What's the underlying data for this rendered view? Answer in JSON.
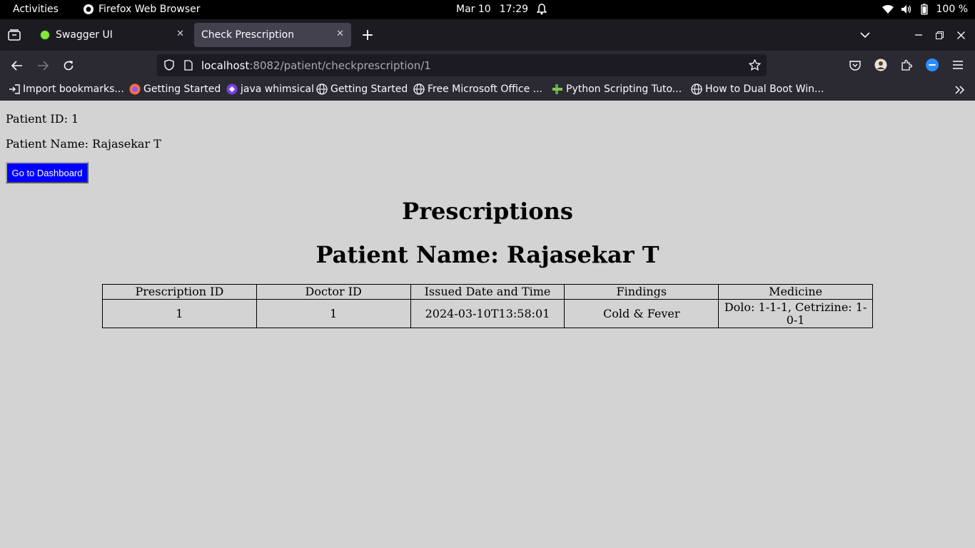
{
  "system_bar": {
    "activities": "Activities",
    "app_name": "Firefox Web Browser",
    "date": "Mar 10",
    "time": "17:29",
    "battery": "100 %"
  },
  "tabs": [
    {
      "label": "Swagger UI",
      "active": false
    },
    {
      "label": "Check Prescription",
      "active": true
    }
  ],
  "address_bar": {
    "host": "localhost",
    "path": ":8082/patient/checkprescription/1"
  },
  "bookmarks": [
    {
      "label": "Import bookmarks...",
      "icon": "import-icon"
    },
    {
      "label": "Getting Started",
      "icon": "firefox-icon"
    },
    {
      "label": "java whimsical",
      "icon": "whimsical-icon"
    },
    {
      "label": "Getting Started",
      "icon": "globe-icon"
    },
    {
      "label": "Free Microsoft Office ...",
      "icon": "globe-icon"
    },
    {
      "label": "Python Scripting Tuto...",
      "icon": "python-icon"
    },
    {
      "label": "How to Dual Boot Win...",
      "icon": "globe-icon"
    }
  ],
  "page": {
    "patient_id": "Patient ID: 1",
    "patient_name": "Patient Name: Rajasekar T",
    "dashboard_button": "Go to Dashboard",
    "heading": "Prescriptions",
    "subheading": "Patient Name: Rajasekar T",
    "table": {
      "headers": [
        "Prescription ID",
        "Doctor ID",
        "Issued Date and Time",
        "Findings",
        "Medicine"
      ],
      "rows": [
        [
          "1",
          "1",
          "2024-03-10T13:58:01",
          "Cold & Fever",
          "Dolo: 1-1-1, Cetrizine: 1-0-1"
        ]
      ]
    }
  },
  "colors": {
    "page_bg": "#d3d3d3",
    "button_bg": "#0000ff",
    "browser_chrome": "#2b2a33"
  }
}
